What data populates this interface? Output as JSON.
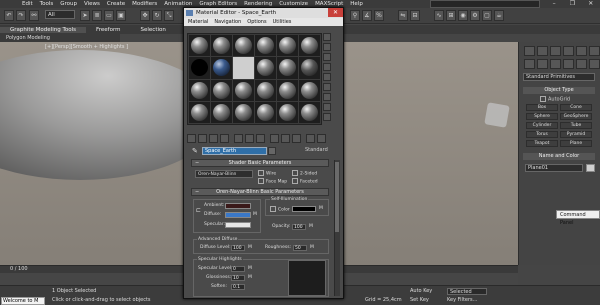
{
  "app": {
    "logo": "◈",
    "menu": [
      "Edit",
      "Tools",
      "Group",
      "Views",
      "Create",
      "Modifiers",
      "Animation",
      "Graph Editors",
      "Rendering",
      "Customize",
      "MAXScript",
      "Help"
    ],
    "window_buttons": [
      "–",
      "❐",
      "✕"
    ]
  },
  "toolbar": {
    "selection_filter": "All"
  },
  "ribbon": {
    "tabs": [
      "Graphite Modeling Tools",
      "Freeform",
      "Selection"
    ],
    "subtitle": "Polygon Modeling"
  },
  "viewport": {
    "label": "[+][Persp][Smooth + Highlights ]",
    "frame": "0 / 100"
  },
  "command_panel": {
    "dropdown": "Standard Primitives",
    "object_type_title": "Object Type",
    "autogrid": "AutoGrid",
    "buttons": [
      [
        "Box",
        "Cone"
      ],
      [
        "Sphere",
        "GeoSphere"
      ],
      [
        "Cylinder",
        "Tube"
      ],
      [
        "Torus",
        "Pyramid"
      ],
      [
        "Teapot",
        "Plane"
      ]
    ],
    "name_color_title": "Name and Color",
    "name_value": "Plane01",
    "tooltip": "Command Panel"
  },
  "status": {
    "maxscript": "Welcome to M",
    "line1": "1 Object Selected",
    "line2": "Click or click-and-drag to select objects",
    "grid": "Grid = 25,4cm",
    "auto_key": "Auto Key",
    "selected": "Selected",
    "set_key": "Set Key",
    "key_filters": "Key Filters..."
  },
  "material_editor": {
    "title": "Material Editor - Space_Earth",
    "menu": [
      "Material",
      "Navigation",
      "Options",
      "Utilities"
    ],
    "material_name": "Space_Earth",
    "material_type": "Standard",
    "shader_params_title": "Shader Basic Parameters",
    "shader": "Oren-Nayar-Blinn",
    "wire": "Wire",
    "two_sided": "2-Sided",
    "face_map": "Face Map",
    "faceted": "Faceted",
    "onb_params_title": "Oren-Nayar-Blinn Basic Parameters",
    "self_illum_title": "Self-Illumination",
    "color_label": "Color",
    "ambient": "Ambient:",
    "diffuse": "Diffuse:",
    "specular": "Specular:",
    "opacity_label": "Opacity:",
    "opacity_value": "100",
    "advanced_diffuse": "Advanced Diffuse",
    "diffuse_level_label": "Diffuse Level:",
    "diffuse_level": "100",
    "roughness_label": "Roughness:",
    "roughness": "50",
    "specular_highlights": "Specular Highlights",
    "specular_level_label": "Specular Level:",
    "specular_level": "0",
    "glossiness_label": "Glossiness:",
    "glossiness": "10",
    "soften_label": "Soften:",
    "soften": "0.1",
    "m_label": "M",
    "colors": {
      "ambient": "#3a1a1a",
      "diffuse": "#3a78c8",
      "specular": "#e6e6e6",
      "self_illum": "#000000",
      "accent": "#2f6fa8"
    }
  }
}
